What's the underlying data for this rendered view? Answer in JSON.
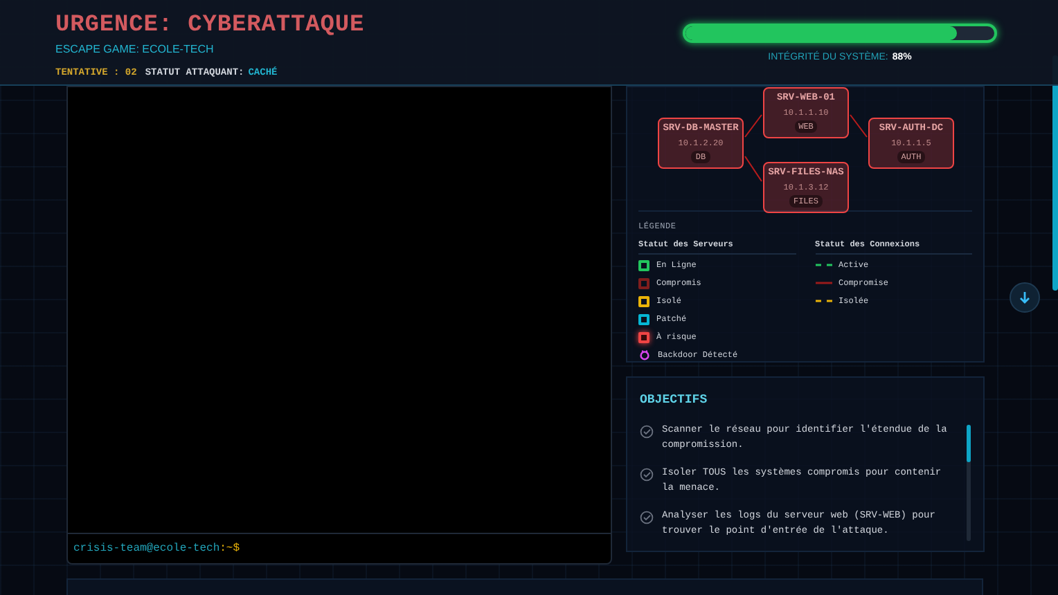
{
  "header": {
    "title": "URGENCE: CYBERATTAQUE",
    "subtitle": "ESCAPE GAME: ECOLE-TECH",
    "attempt_label": "TENTATIVE : 02",
    "attacker_label": "STATUT ATTAQUANT:",
    "attacker_status": "CACHÉ",
    "integrity": {
      "level": 0.88,
      "label": "INTÉGRITÉ DU SYSTÈME:",
      "value": "88%"
    }
  },
  "terminal": {
    "prompt_user": "crisis-team@ecole-tech",
    "prompt_path": ":~$"
  },
  "network_map": {
    "nodes": [
      {
        "name": "SRV-WEB-01",
        "ip": "10.1.1.10",
        "tag": "WEB",
        "color": "#ef4444"
      },
      {
        "name": "SRV-DB-MASTER",
        "ip": "10.1.2.20",
        "tag": "DB",
        "color": "#ef4444"
      },
      {
        "name": "SRV-AUTH-DC",
        "ip": "10.1.1.5",
        "tag": "AUTH",
        "color": "#ef4444"
      },
      {
        "name": "SRV-FILES-NAS",
        "ip": "10.1.3.12",
        "tag": "FILES",
        "color": "#ef4444"
      }
    ],
    "legend": {
      "title": "LÉGENDE",
      "servers_title": "Statut des Serveurs",
      "servers": [
        {
          "label": "En Ligne",
          "kind": "square",
          "color": "#22c55e"
        },
        {
          "label": "Compromis",
          "kind": "square",
          "color": "#7f1d1d"
        },
        {
          "label": "Isolé",
          "kind": "square",
          "color": "#eab308"
        },
        {
          "label": "Patché",
          "kind": "square",
          "color": "#06b6d4"
        },
        {
          "label": "À risque",
          "kind": "glow",
          "color": "#ef4444"
        },
        {
          "label": "Backdoor Détecté",
          "kind": "bug",
          "color": "#d946ef"
        }
      ],
      "connections_title": "Statut des Connexions",
      "connections": [
        {
          "label": "Active",
          "kind": "dashed",
          "color": "#22c55e"
        },
        {
          "label": "Compromise",
          "kind": "solid",
          "color": "#991b1b"
        },
        {
          "label": "Isolée",
          "kind": "dashed",
          "color": "#eab308"
        }
      ]
    }
  },
  "objectives": {
    "title": "OBJECTIFS",
    "items": [
      "Scanner le réseau pour identifier l'étendue de la compromission.",
      "Isoler TOUS les systèmes compromis pour contenir la menace.",
      "Analyser les logs du serveur web (SRV-WEB) pour trouver le point d'entrée de l'attaque."
    ]
  }
}
